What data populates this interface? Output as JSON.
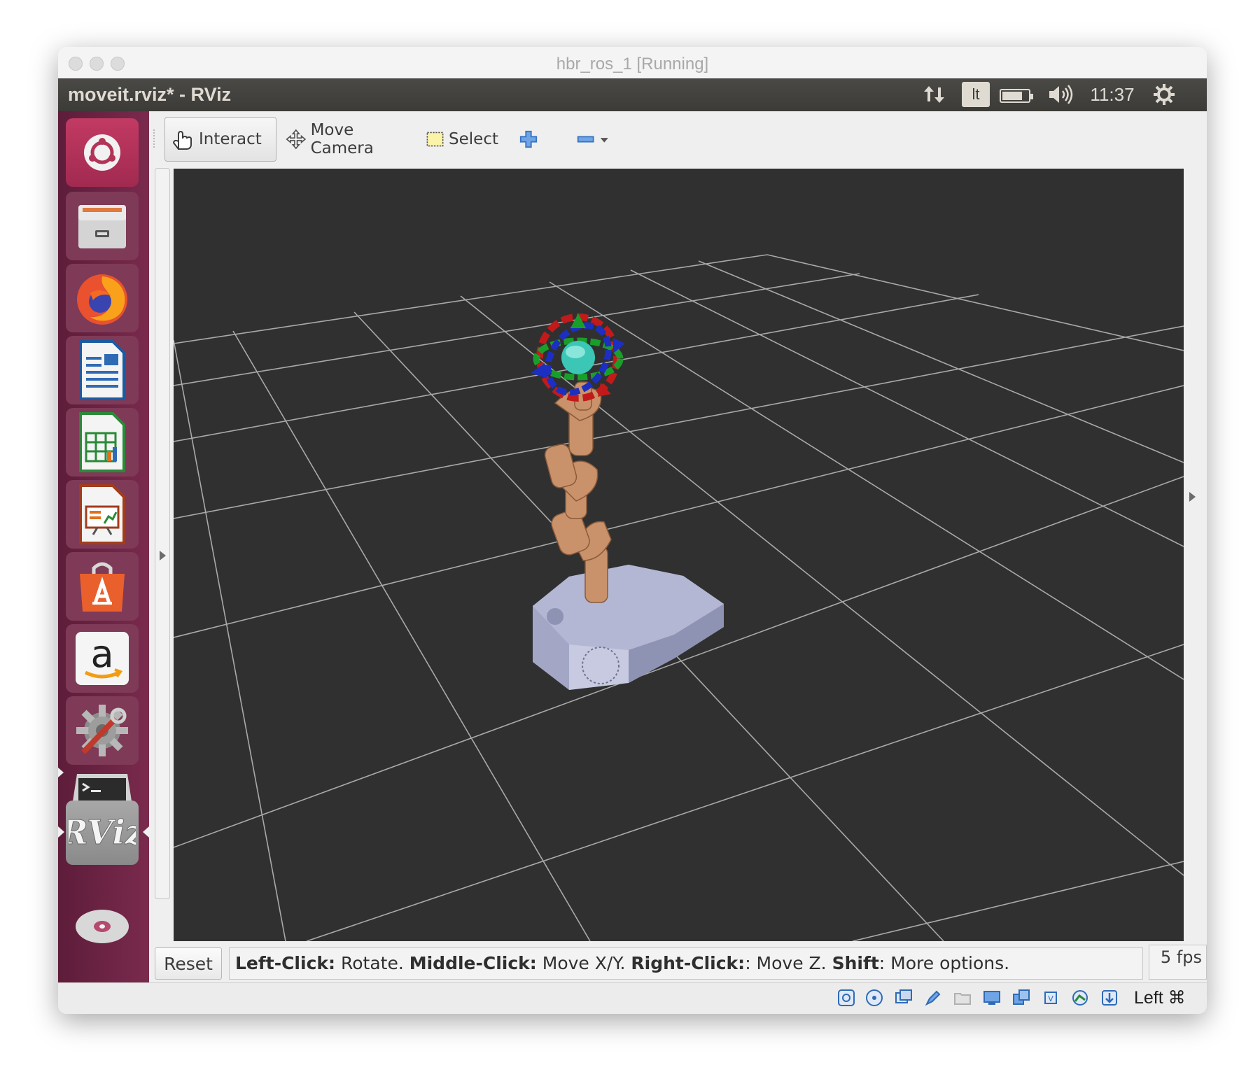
{
  "window": {
    "vm_title": "hbr_ros_1 [Running]"
  },
  "ubuntu_panel": {
    "app_title": "moveit.rviz* - RViz",
    "keyboard_layout": "lt",
    "clock": "11:37"
  },
  "launcher": {
    "items": [
      {
        "icon": "ubuntu-dash-icon"
      },
      {
        "icon": "files-icon"
      },
      {
        "icon": "firefox-icon"
      },
      {
        "icon": "libreoffice-writer-icon"
      },
      {
        "icon": "libreoffice-calc-icon"
      },
      {
        "icon": "libreoffice-impress-icon"
      },
      {
        "icon": "software-center-icon"
      },
      {
        "icon": "amazon-icon"
      },
      {
        "icon": "system-settings-icon"
      },
      {
        "icon": "terminal-icon"
      },
      {
        "icon": "rviz-icon",
        "label": "RViz"
      },
      {
        "icon": "dvd-icon"
      }
    ]
  },
  "toolbar": {
    "interact": "Interact",
    "move_camera": "Move Camera",
    "select": "Select"
  },
  "status": {
    "reset": "Reset",
    "help_left_click": "Left-Click:",
    "help_rotate": " Rotate. ",
    "help_middle_click": "Middle-Click:",
    "help_move_xy": " Move X/Y. ",
    "help_right_click": "Right-Click:",
    "help_move_z": ": Move Z. ",
    "help_shift": "Shift",
    "help_more": ": More options.",
    "fps": "5 fps"
  },
  "vbox_status": {
    "host_key": "Left ⌘"
  },
  "colors": {
    "launcher_bg": "#6b2545",
    "panel_bg": "#3c3b37",
    "viewport_bg": "#303030",
    "grid": "#a0a0a0",
    "robot_arm": "#c9926a",
    "robot_base": "#9ea3c2"
  }
}
